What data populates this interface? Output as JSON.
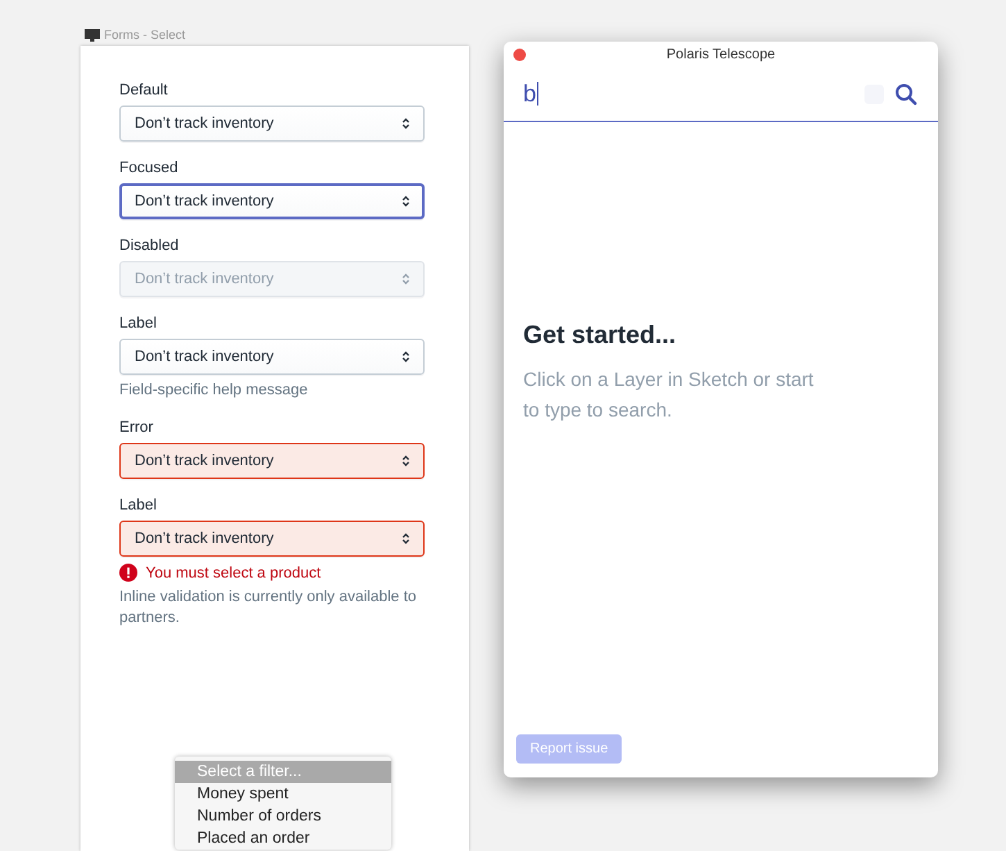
{
  "artboard": {
    "title": "Forms - Select"
  },
  "fields": [
    {
      "label": "Default",
      "value": "Don’t track inventory",
      "kind": "default"
    },
    {
      "label": "Focused",
      "value": "Don’t track inventory",
      "kind": "focused"
    },
    {
      "label": "Disabled",
      "value": "Don’t track inventory",
      "kind": "disabled"
    },
    {
      "label": "Label",
      "value": "Don’t track inventory",
      "kind": "default",
      "help": "Field-specific help message"
    },
    {
      "label": "Error",
      "value": "Don’t track inventory",
      "kind": "error"
    },
    {
      "label": "Label",
      "value": "Don’t track inventory",
      "kind": "error",
      "error": "You must select a product",
      "help": "Inline validation is currently only available to partners."
    }
  ],
  "menu": {
    "items": [
      {
        "label": "Select a filter...",
        "selected": true
      },
      {
        "label": "Money spent",
        "selected": false
      },
      {
        "label": "Number of orders",
        "selected": false
      },
      {
        "label": "Placed an order",
        "selected": false
      }
    ]
  },
  "window": {
    "title": "Polaris Telescope",
    "search": {
      "value": "b"
    },
    "heading": "Get started...",
    "message": "Click on a Layer in Sketch or start to type to search.",
    "button": "Report issue"
  }
}
